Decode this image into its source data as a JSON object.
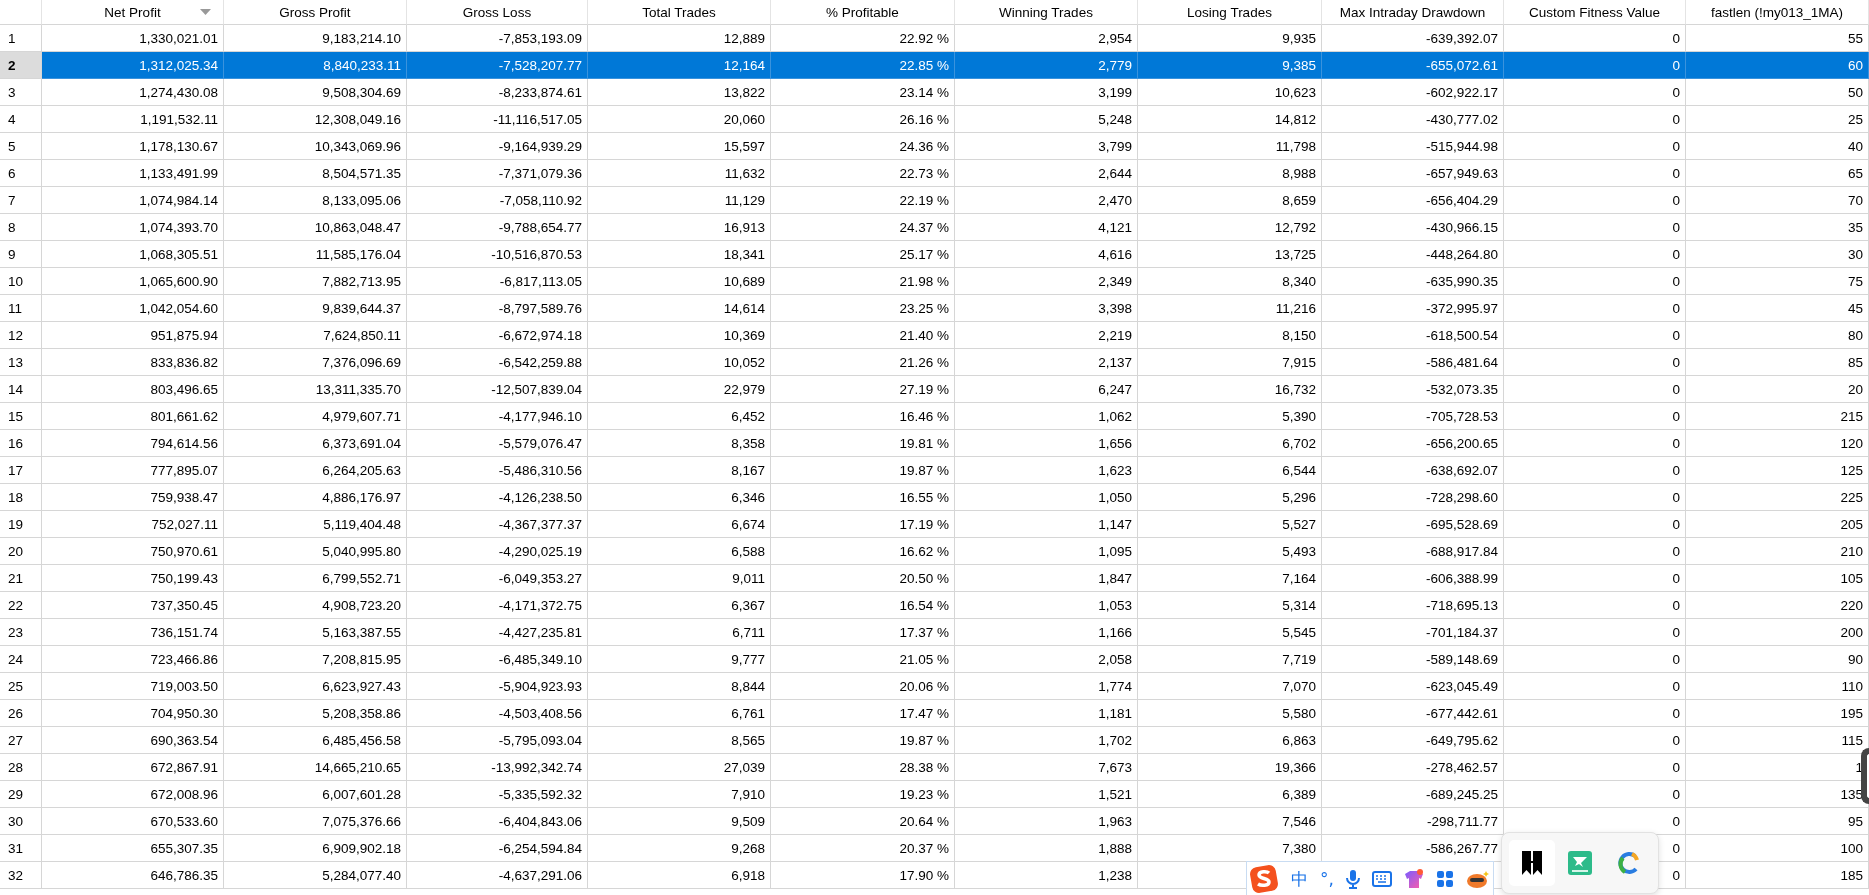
{
  "table": {
    "columns": [
      {
        "label": "Net Profit",
        "sorted": true
      },
      {
        "label": "Gross Profit",
        "sorted": false
      },
      {
        "label": "Gross Loss",
        "sorted": false
      },
      {
        "label": "Total Trades",
        "sorted": false
      },
      {
        "label": "% Profitable",
        "sorted": false
      },
      {
        "label": "Winning Trades",
        "sorted": false
      },
      {
        "label": "Losing Trades",
        "sorted": false
      },
      {
        "label": "Max Intraday Drawdown",
        "sorted": false
      },
      {
        "label": "Custom Fitness Value",
        "sorted": false
      },
      {
        "label": "fastlen (!my013_1MA)",
        "sorted": false
      }
    ],
    "rows": [
      {
        "number": "1",
        "selected": false,
        "cells": [
          "1,330,021.01",
          "9,183,214.10",
          "-7,853,193.09",
          "12,889",
          "22.92 %",
          "2,954",
          "9,935",
          "-639,392.07",
          "0",
          "55"
        ]
      },
      {
        "number": "2",
        "selected": true,
        "cells": [
          "1,312,025.34",
          "8,840,233.11",
          "-7,528,207.77",
          "12,164",
          "22.85 %",
          "2,779",
          "9,385",
          "-655,072.61",
          "0",
          "60"
        ]
      },
      {
        "number": "3",
        "selected": false,
        "cells": [
          "1,274,430.08",
          "9,508,304.69",
          "-8,233,874.61",
          "13,822",
          "23.14 %",
          "3,199",
          "10,623",
          "-602,922.17",
          "0",
          "50"
        ]
      },
      {
        "number": "4",
        "selected": false,
        "cells": [
          "1,191,532.11",
          "12,308,049.16",
          "-11,116,517.05",
          "20,060",
          "26.16 %",
          "5,248",
          "14,812",
          "-430,777.02",
          "0",
          "25"
        ]
      },
      {
        "number": "5",
        "selected": false,
        "cells": [
          "1,178,130.67",
          "10,343,069.96",
          "-9,164,939.29",
          "15,597",
          "24.36 %",
          "3,799",
          "11,798",
          "-515,944.98",
          "0",
          "40"
        ]
      },
      {
        "number": "6",
        "selected": false,
        "cells": [
          "1,133,491.99",
          "8,504,571.35",
          "-7,371,079.36",
          "11,632",
          "22.73 %",
          "2,644",
          "8,988",
          "-657,949.63",
          "0",
          "65"
        ]
      },
      {
        "number": "7",
        "selected": false,
        "cells": [
          "1,074,984.14",
          "8,133,095.06",
          "-7,058,110.92",
          "11,129",
          "22.19 %",
          "2,470",
          "8,659",
          "-656,404.29",
          "0",
          "70"
        ]
      },
      {
        "number": "8",
        "selected": false,
        "cells": [
          "1,074,393.70",
          "10,863,048.47",
          "-9,788,654.77",
          "16,913",
          "24.37 %",
          "4,121",
          "12,792",
          "-430,966.15",
          "0",
          "35"
        ]
      },
      {
        "number": "9",
        "selected": false,
        "cells": [
          "1,068,305.51",
          "11,585,176.04",
          "-10,516,870.53",
          "18,341",
          "25.17 %",
          "4,616",
          "13,725",
          "-448,264.80",
          "0",
          "30"
        ]
      },
      {
        "number": "10",
        "selected": false,
        "cells": [
          "1,065,600.90",
          "7,882,713.95",
          "-6,817,113.05",
          "10,689",
          "21.98 %",
          "2,349",
          "8,340",
          "-635,990.35",
          "0",
          "75"
        ]
      },
      {
        "number": "11",
        "selected": false,
        "cells": [
          "1,042,054.60",
          "9,839,644.37",
          "-8,797,589.76",
          "14,614",
          "23.25 %",
          "3,398",
          "11,216",
          "-372,995.97",
          "0",
          "45"
        ]
      },
      {
        "number": "12",
        "selected": false,
        "cells": [
          "951,875.94",
          "7,624,850.11",
          "-6,672,974.18",
          "10,369",
          "21.40 %",
          "2,219",
          "8,150",
          "-618,500.54",
          "0",
          "80"
        ]
      },
      {
        "number": "13",
        "selected": false,
        "cells": [
          "833,836.82",
          "7,376,096.69",
          "-6,542,259.88",
          "10,052",
          "21.26 %",
          "2,137",
          "7,915",
          "-586,481.64",
          "0",
          "85"
        ]
      },
      {
        "number": "14",
        "selected": false,
        "cells": [
          "803,496.65",
          "13,311,335.70",
          "-12,507,839.04",
          "22,979",
          "27.19 %",
          "6,247",
          "16,732",
          "-532,073.35",
          "0",
          "20"
        ]
      },
      {
        "number": "15",
        "selected": false,
        "cells": [
          "801,661.62",
          "4,979,607.71",
          "-4,177,946.10",
          "6,452",
          "16.46 %",
          "1,062",
          "5,390",
          "-705,728.53",
          "0",
          "215"
        ]
      },
      {
        "number": "16",
        "selected": false,
        "cells": [
          "794,614.56",
          "6,373,691.04",
          "-5,579,076.47",
          "8,358",
          "19.81 %",
          "1,656",
          "6,702",
          "-656,200.65",
          "0",
          "120"
        ]
      },
      {
        "number": "17",
        "selected": false,
        "cells": [
          "777,895.07",
          "6,264,205.63",
          "-5,486,310.56",
          "8,167",
          "19.87 %",
          "1,623",
          "6,544",
          "-638,692.07",
          "0",
          "125"
        ]
      },
      {
        "number": "18",
        "selected": false,
        "cells": [
          "759,938.47",
          "4,886,176.97",
          "-4,126,238.50",
          "6,346",
          "16.55 %",
          "1,050",
          "5,296",
          "-728,298.60",
          "0",
          "225"
        ]
      },
      {
        "number": "19",
        "selected": false,
        "cells": [
          "752,027.11",
          "5,119,404.48",
          "-4,367,377.37",
          "6,674",
          "17.19 %",
          "1,147",
          "5,527",
          "-695,528.69",
          "0",
          "205"
        ]
      },
      {
        "number": "20",
        "selected": false,
        "cells": [
          "750,970.61",
          "5,040,995.80",
          "-4,290,025.19",
          "6,588",
          "16.62 %",
          "1,095",
          "5,493",
          "-688,917.84",
          "0",
          "210"
        ]
      },
      {
        "number": "21",
        "selected": false,
        "cells": [
          "750,199.43",
          "6,799,552.71",
          "-6,049,353.27",
          "9,011",
          "20.50 %",
          "1,847",
          "7,164",
          "-606,388.99",
          "0",
          "105"
        ]
      },
      {
        "number": "22",
        "selected": false,
        "cells": [
          "737,350.45",
          "4,908,723.20",
          "-4,171,372.75",
          "6,367",
          "16.54 %",
          "1,053",
          "5,314",
          "-718,695.13",
          "0",
          "220"
        ]
      },
      {
        "number": "23",
        "selected": false,
        "cells": [
          "736,151.74",
          "5,163,387.55",
          "-4,427,235.81",
          "6,711",
          "17.37 %",
          "1,166",
          "5,545",
          "-701,184.37",
          "0",
          "200"
        ]
      },
      {
        "number": "24",
        "selected": false,
        "cells": [
          "723,466.86",
          "7,208,815.95",
          "-6,485,349.10",
          "9,777",
          "21.05 %",
          "2,058",
          "7,719",
          "-589,148.69",
          "0",
          "90"
        ]
      },
      {
        "number": "25",
        "selected": false,
        "cells": [
          "719,003.50",
          "6,623,927.43",
          "-5,904,923.93",
          "8,844",
          "20.06 %",
          "1,774",
          "7,070",
          "-623,045.49",
          "0",
          "110"
        ]
      },
      {
        "number": "26",
        "selected": false,
        "cells": [
          "704,950.30",
          "5,208,358.86",
          "-4,503,408.56",
          "6,761",
          "17.47 %",
          "1,181",
          "5,580",
          "-677,442.61",
          "0",
          "195"
        ]
      },
      {
        "number": "27",
        "selected": false,
        "cells": [
          "690,363.54",
          "6,485,456.58",
          "-5,795,093.04",
          "8,565",
          "19.87 %",
          "1,702",
          "6,863",
          "-649,795.62",
          "0",
          "115"
        ]
      },
      {
        "number": "28",
        "selected": false,
        "cells": [
          "672,867.91",
          "14,665,210.65",
          "-13,992,342.74",
          "27,039",
          "28.38 %",
          "7,673",
          "19,366",
          "-278,462.57",
          "0",
          "1"
        ]
      },
      {
        "number": "29",
        "selected": false,
        "cells": [
          "672,008.96",
          "6,007,601.28",
          "-5,335,592.32",
          "7,910",
          "19.23 %",
          "1,521",
          "6,389",
          "-689,245.25",
          "0",
          "135"
        ]
      },
      {
        "number": "30",
        "selected": false,
        "cells": [
          "670,533.60",
          "7,075,376.66",
          "-6,404,843.06",
          "9,509",
          "20.64 %",
          "1,963",
          "7,546",
          "-298,711.77",
          "0",
          "95"
        ]
      },
      {
        "number": "31",
        "selected": false,
        "cells": [
          "655,307.35",
          "6,909,902.18",
          "-6,254,594.84",
          "9,268",
          "20.37 %",
          "1,888",
          "7,380",
          "-586,267.77",
          "0",
          "100"
        ]
      },
      {
        "number": "32",
        "selected": false,
        "cells": [
          "646,786.35",
          "5,284,077.40",
          "-4,637,291.06",
          "6,918",
          "17.90 %",
          "1,238",
          null,
          null,
          "0",
          "185"
        ]
      }
    ]
  },
  "ime_toolbar": {
    "language": "中",
    "punctuation": "°,"
  }
}
